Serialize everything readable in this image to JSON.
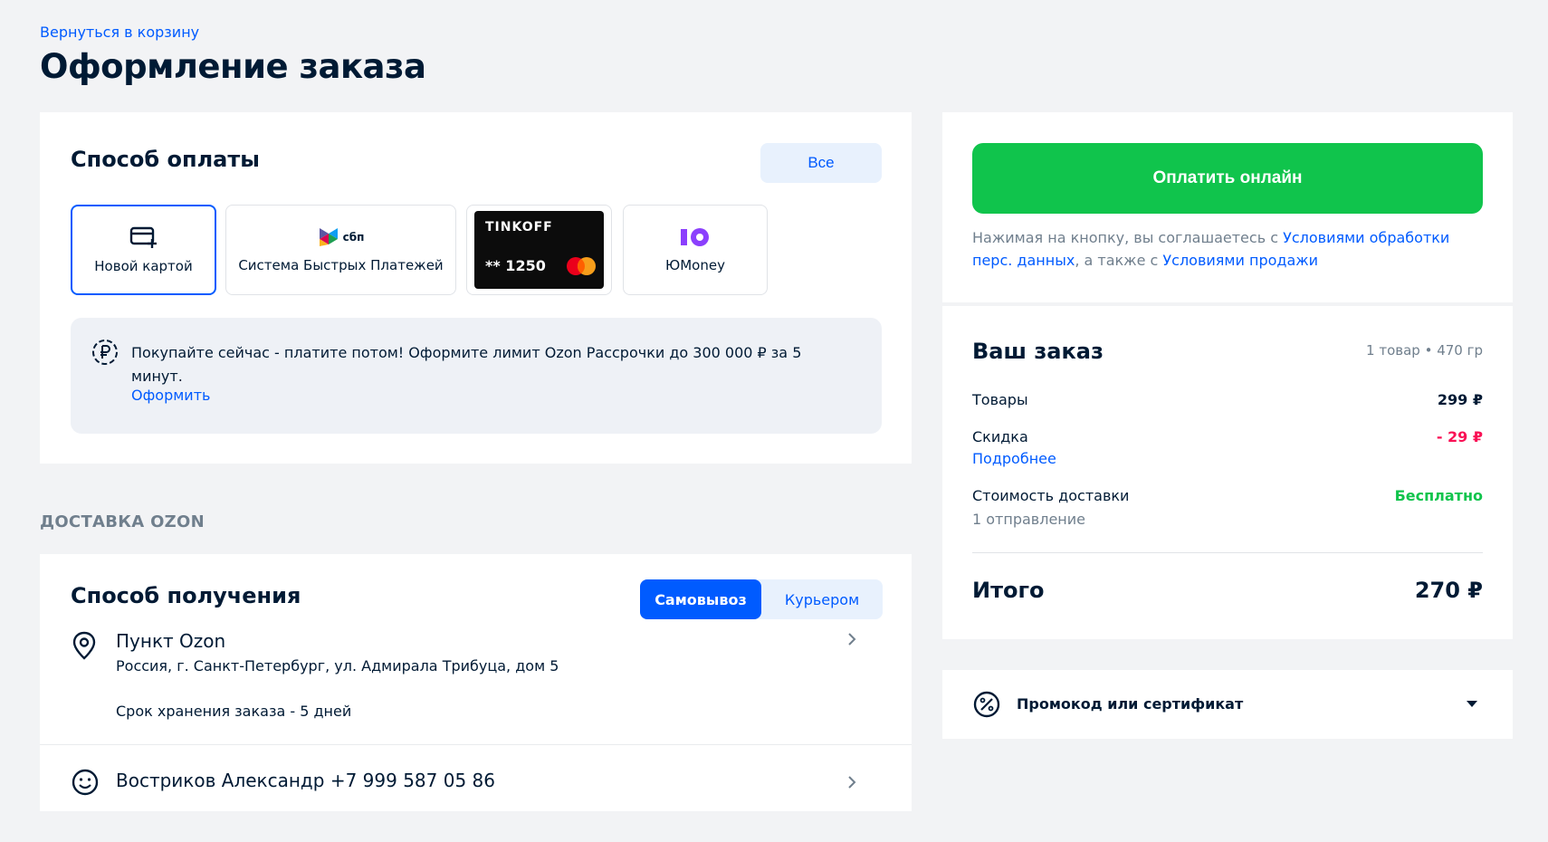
{
  "header": {
    "back_link": "Вернуться в корзину",
    "title": "Оформление заказа"
  },
  "payment": {
    "title": "Способ оплаты",
    "all_button": "Все",
    "methods": [
      {
        "label": "Новой картой",
        "icon": "card-plus-icon",
        "selected": true
      },
      {
        "label": "Система Быстрых Платежей",
        "logo_text": "сбп",
        "icon": "sbp-logo-icon"
      },
      {
        "brand": "TINKOFF",
        "card_number": "** 1250",
        "icon": "mastercard-icon"
      },
      {
        "label": "ЮMoney",
        "icon": "yoomoney-logo-icon"
      }
    ],
    "installment": {
      "text": "Покупайте сейчас - платите потом! Оформите лимит Ozon Рассрочки до 300 000 ₽ за 5 минут.",
      "link": "Оформить",
      "icon": "ruble-circle-icon"
    }
  },
  "delivery": {
    "section_label": "ДОСТАВКА OZON",
    "title": "Способ получения",
    "tabs": [
      {
        "label": "Самовывоз",
        "active": true
      },
      {
        "label": "Курьером",
        "active": false
      }
    ],
    "point": {
      "name": "Пункт Ozon",
      "address": "Россия, г. Санкт-Петербург, ул. Адмирала Трибуца, дом 5",
      "storage": "Срок хранения заказа - 5  дней",
      "icon": "map-pin-icon"
    },
    "recipient": {
      "text": "Востриков Александр +7 999 587 05 86",
      "icon": "smiley-icon"
    }
  },
  "checkout": {
    "pay_button": "Оплатить онлайн",
    "consent_prefix": "Нажимая на кнопку, вы соглашаетесь с ",
    "consent_link1": "Условиями обработки перс. данных",
    "consent_middle": ", а также с ",
    "consent_link2": "Условиями продажи"
  },
  "summary": {
    "title": "Ваш заказ",
    "meta": "1 товар • 470 гр",
    "goods_label": "Товары",
    "goods_value": "299 ₽",
    "discount_label": "Скидка",
    "discount_value": "- 29 ₽",
    "discount_more": "Подробнее",
    "shipping_label": "Стоимость доставки",
    "shipping_value": "Бесплатно",
    "shipping_sub": "1  отправление",
    "total_label": "Итого",
    "total_value": "270 ₽"
  },
  "promo": {
    "label": "Промокод или сертификат",
    "icon": "percent-circle-icon"
  },
  "colors": {
    "accent": "#005bff",
    "pay_green": "#10c44c",
    "discount_red": "#f91155",
    "background": "#f2f3f5"
  }
}
